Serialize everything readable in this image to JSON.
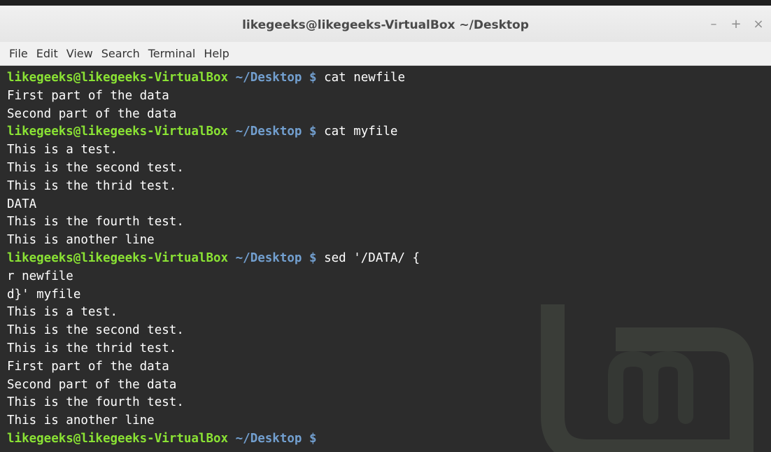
{
  "window": {
    "title": "likegeeks@likegeeks-VirtualBox ~/Desktop",
    "controls": {
      "minimize": "–",
      "maximize": "+",
      "close": "×"
    }
  },
  "menu": [
    "File",
    "Edit",
    "View",
    "Search",
    "Terminal",
    "Help"
  ],
  "prompt": {
    "user_host": "likegeeks@likegeeks-VirtualBox",
    "path": "~/Desktop",
    "symbol": "$"
  },
  "colors": {
    "prompt_user": "#8ae234",
    "prompt_path": "#729fcf",
    "terminal_bg": "#2c2c2c",
    "text": "#ffffff"
  },
  "terminal_lines": [
    {
      "type": "prompt",
      "command": "cat newfile"
    },
    {
      "type": "output",
      "text": "First part of the data"
    },
    {
      "type": "output",
      "text": "Second part of the data"
    },
    {
      "type": "prompt",
      "command": "cat myfile"
    },
    {
      "type": "output",
      "text": "This is a test."
    },
    {
      "type": "output",
      "text": "This is the second test."
    },
    {
      "type": "output",
      "text": "This is the thrid test."
    },
    {
      "type": "output",
      "text": "DATA"
    },
    {
      "type": "output",
      "text": "This is the fourth test."
    },
    {
      "type": "output",
      "text": "This is another line"
    },
    {
      "type": "prompt",
      "command": "sed '/DATA/ {"
    },
    {
      "type": "output",
      "text": "r newfile"
    },
    {
      "type": "output",
      "text": "d}' myfile"
    },
    {
      "type": "output",
      "text": "This is a test."
    },
    {
      "type": "output",
      "text": "This is the second test."
    },
    {
      "type": "output",
      "text": "This is the thrid test."
    },
    {
      "type": "output",
      "text": "First part of the data"
    },
    {
      "type": "output",
      "text": "Second part of the data"
    },
    {
      "type": "output",
      "text": "This is the fourth test."
    },
    {
      "type": "output",
      "text": "This is another line"
    },
    {
      "type": "prompt",
      "command": ""
    }
  ]
}
